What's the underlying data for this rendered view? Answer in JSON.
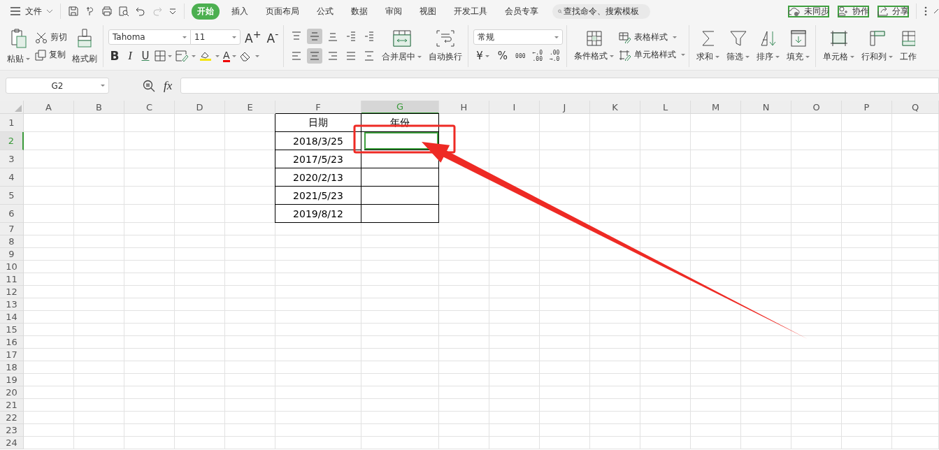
{
  "menu": {
    "file_label": "文件"
  },
  "tabs": [
    {
      "label": "开始",
      "selected": true
    },
    {
      "label": "插入",
      "selected": false
    },
    {
      "label": "页面布局",
      "selected": false
    },
    {
      "label": "公式",
      "selected": false
    },
    {
      "label": "数据",
      "selected": false
    },
    {
      "label": "审阅",
      "selected": false
    },
    {
      "label": "视图",
      "selected": false
    },
    {
      "label": "开发工具",
      "selected": false
    },
    {
      "label": "会员专享",
      "selected": false
    }
  ],
  "search": {
    "placeholder": "查找命令、搜索模板"
  },
  "actions": [
    "未同步",
    "协作",
    "分享"
  ],
  "ribbon": {
    "paste": "粘贴",
    "cut": "剪切",
    "copy": "复制",
    "format_painter": "格式刷",
    "font": "Tahoma",
    "font_size": "11",
    "grow_font": "A$^{+}$",
    "shrink_font": "A$^{-}$",
    "bold": "B",
    "italic": "I",
    "underline": "U",
    "font_color": "A",
    "align_buttons": [
      {
        "kind": "top",
        "selected": false
      },
      {
        "kind": "middle",
        "selected": true
      },
      {
        "kind": "bottom",
        "selected": false
      },
      {
        "kind": "outdent",
        "selected": false
      },
      {
        "kind": "indent",
        "selected": false
      },
      {
        "kind": "left",
        "selected": false
      },
      {
        "kind": "center",
        "selected": true
      },
      {
        "kind": "right",
        "selected": false
      },
      {
        "kind": "justify",
        "selected": false
      },
      {
        "kind": "distributed",
        "selected": false
      }
    ],
    "merge": "合并居中",
    "wrap": "自动换行",
    "number_format": "常规",
    "currency": "¥",
    "percent": "%",
    "thousands": "000",
    "decimal_add": [
      "←.0",
      ".00"
    ],
    "decimal_remove": [
      ".00",
      "→.0"
    ],
    "conditional": "条件格式",
    "table_style": "表格样式",
    "cell_style": "单元格样式",
    "sum": "求和",
    "filter": "筛选",
    "sort": "排序",
    "fill": "填充",
    "cell": "单元格",
    "rows_cols": "行和列",
    "worksheet": "工作"
  },
  "formula_bar": {
    "name_box": "G2",
    "fx": "fx"
  },
  "sheet": {
    "columns": [
      {
        "label": "A",
        "selected": false
      },
      {
        "label": "B",
        "selected": false
      },
      {
        "label": "C",
        "selected": false
      },
      {
        "label": "D",
        "selected": false
      },
      {
        "label": "E",
        "selected": false
      },
      {
        "label": "F",
        "selected": false,
        "bordered": true
      },
      {
        "label": "G",
        "selected": true,
        "bordered": true
      },
      {
        "label": "H",
        "selected": false
      },
      {
        "label": "I",
        "selected": false
      },
      {
        "label": "J",
        "selected": false
      },
      {
        "label": "K",
        "selected": false
      },
      {
        "label": "L",
        "selected": false
      },
      {
        "label": "M",
        "selected": false
      },
      {
        "label": "N",
        "selected": false
      },
      {
        "label": "O",
        "selected": false
      },
      {
        "label": "P",
        "selected": false
      },
      {
        "label": "Q",
        "selected": false
      }
    ],
    "rows": [
      {
        "label": "1",
        "selected": false,
        "cells": [
          {
            "text": "日期"
          },
          {
            "text": "年份"
          }
        ]
      },
      {
        "label": "2",
        "selected": true,
        "cells": [
          {
            "text": "2018/3/25"
          },
          {}
        ]
      },
      {
        "label": "3",
        "selected": false,
        "cells": [
          {
            "text": "2017/5/23"
          },
          {}
        ]
      },
      {
        "label": "4",
        "selected": false,
        "cells": [
          {
            "text": "2020/2/13"
          },
          {}
        ]
      },
      {
        "label": "5",
        "selected": false,
        "cells": [
          {
            "text": "2021/5/23"
          },
          {}
        ]
      },
      {
        "label": "6",
        "selected": false,
        "cells": [
          {
            "text": "2019/8/12"
          },
          {}
        ]
      },
      {
        "label": "7",
        "selected": false
      },
      {
        "label": "8",
        "selected": false
      },
      {
        "label": "9",
        "selected": false
      },
      {
        "label": "10",
        "selected": false
      },
      {
        "label": "11",
        "selected": false
      },
      {
        "label": "12",
        "selected": false
      },
      {
        "label": "13",
        "selected": false
      },
      {
        "label": "14",
        "selected": false
      },
      {
        "label": "15",
        "selected": false
      },
      {
        "label": "16",
        "selected": false
      },
      {
        "label": "17",
        "selected": false
      },
      {
        "label": "18",
        "selected": false
      },
      {
        "label": "19",
        "selected": false
      },
      {
        "label": "20",
        "selected": false
      },
      {
        "label": "21",
        "selected": false
      },
      {
        "label": "22",
        "selected": false
      },
      {
        "label": "23",
        "selected": false
      },
      {
        "label": "24",
        "selected": false
      }
    ]
  }
}
